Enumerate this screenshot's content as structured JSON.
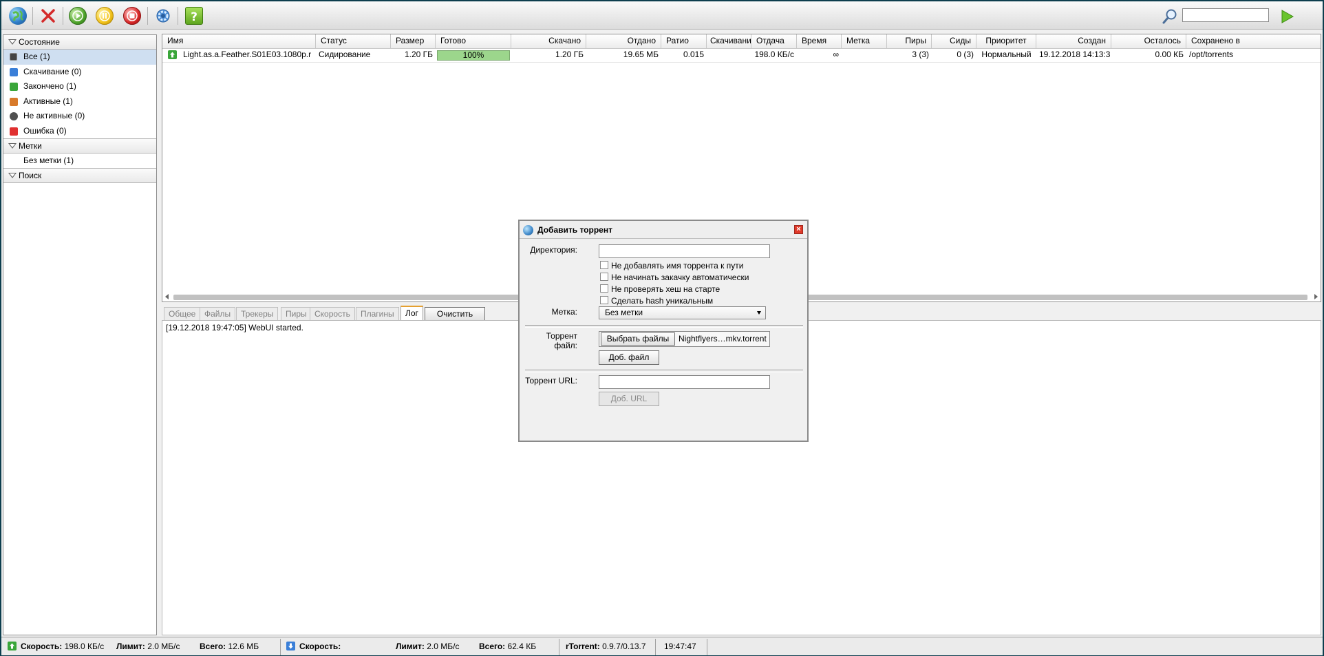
{
  "toolbar": {
    "buttons": [
      "add-torrent",
      "remove",
      "start",
      "pause",
      "stop",
      "settings",
      "help"
    ],
    "search_value": ""
  },
  "sidebar": {
    "state_header": "Состояние",
    "states": [
      {
        "label": "Все (1)",
        "icon": "all-icon",
        "color": "#5b5b5b"
      },
      {
        "label": "Скачивание (0)",
        "icon": "download-icon",
        "color": "#3a7fd8"
      },
      {
        "label": "Закончено (1)",
        "icon": "finished-icon",
        "color": "#3aa63a"
      },
      {
        "label": "Активные (1)",
        "icon": "active-icon",
        "color": "#d87a2a"
      },
      {
        "label": "Не активные (0)",
        "icon": "inactive-icon",
        "color": "#505050"
      },
      {
        "label": "Ошибка (0)",
        "icon": "error-icon",
        "color": "#e03030"
      }
    ],
    "labels_header": "Метки",
    "labels": [
      {
        "label": "Без метки (1)"
      }
    ],
    "search_header": "Поиск"
  },
  "list": {
    "columns": [
      "Имя",
      "Статус",
      "Размер",
      "Готово",
      "Скачано",
      "Отдано",
      "Ратио",
      "Скачивани",
      "Отдача",
      "Время",
      "Метка",
      "Пиры",
      "Сиды",
      "Приоритет",
      "Создан",
      "Осталось",
      "Сохранено в"
    ],
    "row": {
      "name": "Light.as.a.Feather.S01E03.1080p.r",
      "status": "Сидирование",
      "size": "1.20 ГБ",
      "done": "100%",
      "done_fraction": 1.0,
      "downloaded": "1.20 ГБ",
      "uploaded": "19.65 МБ",
      "ratio": "0.015",
      "dl_speed": "",
      "ul_speed": "198.0 КБ/с",
      "eta": "∞",
      "label": "",
      "peers": "3 (3)",
      "seeds": "0 (3)",
      "priority": "Нормальный",
      "created": "19.12.2018 14:13:3",
      "remaining": "0.00 КБ",
      "saved_to": "/opt/torrents"
    }
  },
  "tabs": {
    "items": [
      "Общее",
      "Файлы",
      "Трекеры",
      "Пиры",
      "Скорость",
      "Плагины",
      "Лог"
    ],
    "active": "Лог",
    "clear_label": "Очистить"
  },
  "log": {
    "lines": [
      "[19.12.2018 19:47:05] WebUI started."
    ]
  },
  "dialog": {
    "title": "Добавить торрент",
    "dir_label": "Директория:",
    "dir_value": "",
    "checkboxes": [
      "Не добавлять имя торрента к пути",
      "Не начинать закачку автоматически",
      "Не проверять хеш на старте",
      "Сделать hash уникальным"
    ],
    "label_label": "Метка:",
    "label_value": "Без метки",
    "file_label_1": "Торрент",
    "file_label_2": "файл:",
    "choose_files": "Выбрать файлы",
    "file_name": "Nightflyers…mkv.torrent",
    "add_file": "Доб. файл",
    "url_label": "Торрент URL:",
    "url_value": "",
    "add_url": "Доб. URL"
  },
  "status": {
    "up_speed_label": "Скорость:",
    "up_speed": "198.0 КБ/с",
    "up_limit_label": "Лимит:",
    "up_limit": "2.0 МБ/с",
    "up_total_label": "Всего:",
    "up_total": "12.6 МБ",
    "dn_speed_label": "Скорость:",
    "dn_speed": "",
    "dn_limit_label": "Лимит:",
    "dn_limit": "2.0 МБ/с",
    "dn_total_label": "Всего:",
    "dn_total": "62.4 КБ",
    "client_label": "rTorrent:",
    "client_version": "0.9.7/0.13.7",
    "time": "19:47:47"
  }
}
